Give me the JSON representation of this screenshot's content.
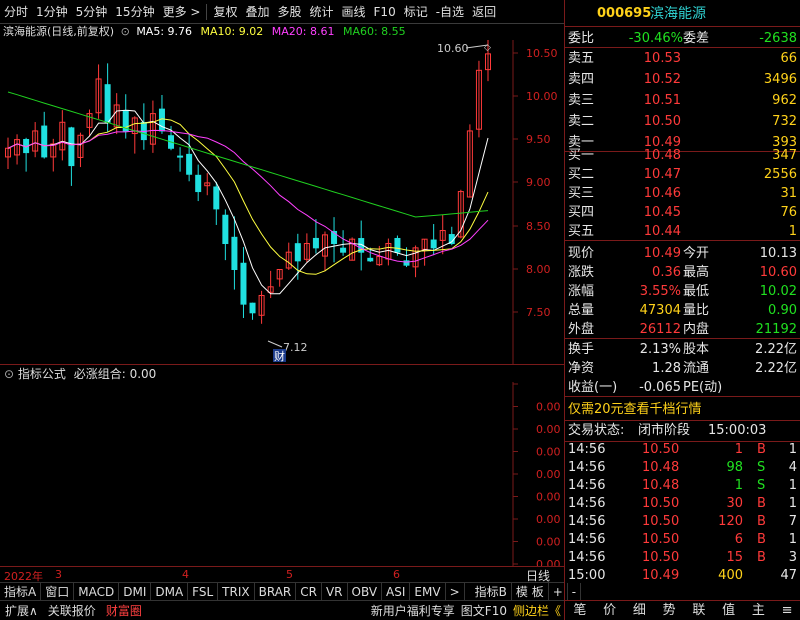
{
  "toolbar": {
    "items": [
      "分时",
      "1分钟",
      "5分钟",
      "15分钟",
      "更多 >",
      "复权",
      "叠加",
      "多股",
      "统计",
      "画线",
      "F10",
      "标记",
      "-自选",
      "返回"
    ]
  },
  "chart": {
    "title": "滨海能源(日线,前复权)",
    "ma5": "MA5: 9.76",
    "ma10": "MA10: 9.02",
    "ma20": "MA20: 8.61",
    "ma60": "MA60: 8.55",
    "price_ticks": [
      "10.50",
      "10.00",
      "9.50",
      "9.00",
      "8.50",
      "8.00",
      "7.50"
    ],
    "high_label": "10.60",
    "low_label": "7.12",
    "cai_label": "财"
  },
  "indicator": {
    "name": "指标公式",
    "combo": "必涨组合: 0.00",
    "ticks": [
      "0.00",
      "0.00",
      "0.00",
      "0.00",
      "0.00",
      "0.00",
      "0.00",
      "0.00",
      "0.00"
    ]
  },
  "time_axis": {
    "year": "2022年",
    "months": [
      "3",
      "4",
      "5",
      "6"
    ],
    "day_label": "日线"
  },
  "tabs": [
    "指标A",
    "窗口",
    "MACD",
    "DMI",
    "DMA",
    "FSL",
    "TRIX",
    "BRAR",
    "CR",
    "VR",
    "OBV",
    "ASI",
    "EMV",
    ">",
    "指标B",
    "模 板",
    "+",
    "-"
  ],
  "bottom_bar": {
    "left": [
      "扩展∧",
      "关联报价",
      "财富圈"
    ],
    "right": [
      "新用户福利专享",
      "图文F10",
      "侧边栏《"
    ]
  },
  "quote": {
    "code": "000695",
    "name": "滨海能源",
    "weibi_label": "委比",
    "weibi": "-30.46%",
    "weicha_label": "委差",
    "weicha": "-2638",
    "asks": [
      {
        "label": "卖五",
        "price": "10.53",
        "vol": "66"
      },
      {
        "label": "卖四",
        "price": "10.52",
        "vol": "3496"
      },
      {
        "label": "卖三",
        "price": "10.51",
        "vol": "962"
      },
      {
        "label": "卖二",
        "price": "10.50",
        "vol": "732"
      },
      {
        "label": "卖一",
        "price": "10.49",
        "vol": "393"
      }
    ],
    "bids": [
      {
        "label": "买一",
        "price": "10.48",
        "vol": "347"
      },
      {
        "label": "买二",
        "price": "10.47",
        "vol": "2556"
      },
      {
        "label": "买三",
        "price": "10.46",
        "vol": "31"
      },
      {
        "label": "买四",
        "price": "10.45",
        "vol": "76"
      },
      {
        "label": "买五",
        "price": "10.44",
        "vol": "1"
      }
    ],
    "stats": [
      {
        "l1": "现价",
        "v1": "10.49",
        "c1": "r",
        "l2": "今开",
        "v2": "10.13",
        "c2": "w"
      },
      {
        "l1": "涨跌",
        "v1": "0.36",
        "c1": "r",
        "l2": "最高",
        "v2": "10.60",
        "c2": "r"
      },
      {
        "l1": "涨幅",
        "v1": "3.55%",
        "c1": "r",
        "l2": "最低",
        "v2": "10.02",
        "c2": "g"
      },
      {
        "l1": "总量",
        "v1": "47304",
        "c1": "y",
        "l2": "量比",
        "v2": "0.90",
        "c2": "g"
      },
      {
        "l1": "外盘",
        "v1": "26112",
        "c1": "r",
        "l2": "内盘",
        "v2": "21192",
        "c2": "g"
      }
    ],
    "stats2": [
      {
        "l1": "换手",
        "v1": "2.13%",
        "l2": "股本",
        "v2": "2.22亿"
      },
      {
        "l1": "净资",
        "v1": "1.28",
        "l2": "流通",
        "v2": "2.22亿"
      },
      {
        "l1": "收益(一)",
        "v1": "-0.065",
        "l2": "PE(动)",
        "v2": ""
      }
    ],
    "promo": "仅需20元查看千档行情",
    "trade_status_label": "交易状态:",
    "trade_status": "闭市阶段",
    "trade_time": "15:00:03",
    "ticks": [
      {
        "t": "14:56",
        "p": "10.50",
        "v": "1",
        "d": "B",
        "n": "1"
      },
      {
        "t": "14:56",
        "p": "10.48",
        "v": "98",
        "d": "S",
        "n": "4"
      },
      {
        "t": "14:56",
        "p": "10.48",
        "v": "1",
        "d": "S",
        "n": "1"
      },
      {
        "t": "14:56",
        "p": "10.50",
        "v": "30",
        "d": "B",
        "n": "1"
      },
      {
        "t": "14:56",
        "p": "10.50",
        "v": "120",
        "d": "B",
        "n": "7"
      },
      {
        "t": "14:56",
        "p": "10.50",
        "v": "6",
        "d": "B",
        "n": "1"
      },
      {
        "t": "14:56",
        "p": "10.50",
        "v": "15",
        "d": "B",
        "n": "3"
      },
      {
        "t": "15:00",
        "p": "10.49",
        "v": "400",
        "d": "",
        "n": "47"
      }
    ],
    "bottom_tabs": [
      "笔",
      "价",
      "细",
      "势",
      "联",
      "值",
      "主",
      "≡"
    ]
  },
  "colors": {
    "up": "#ff3a3a",
    "down": "#20e0e0",
    "ma5": "#ffffff",
    "ma10": "#ffff40",
    "ma20": "#ff40ff",
    "ma60": "#20d020",
    "axis": "#7a1a1a"
  }
}
